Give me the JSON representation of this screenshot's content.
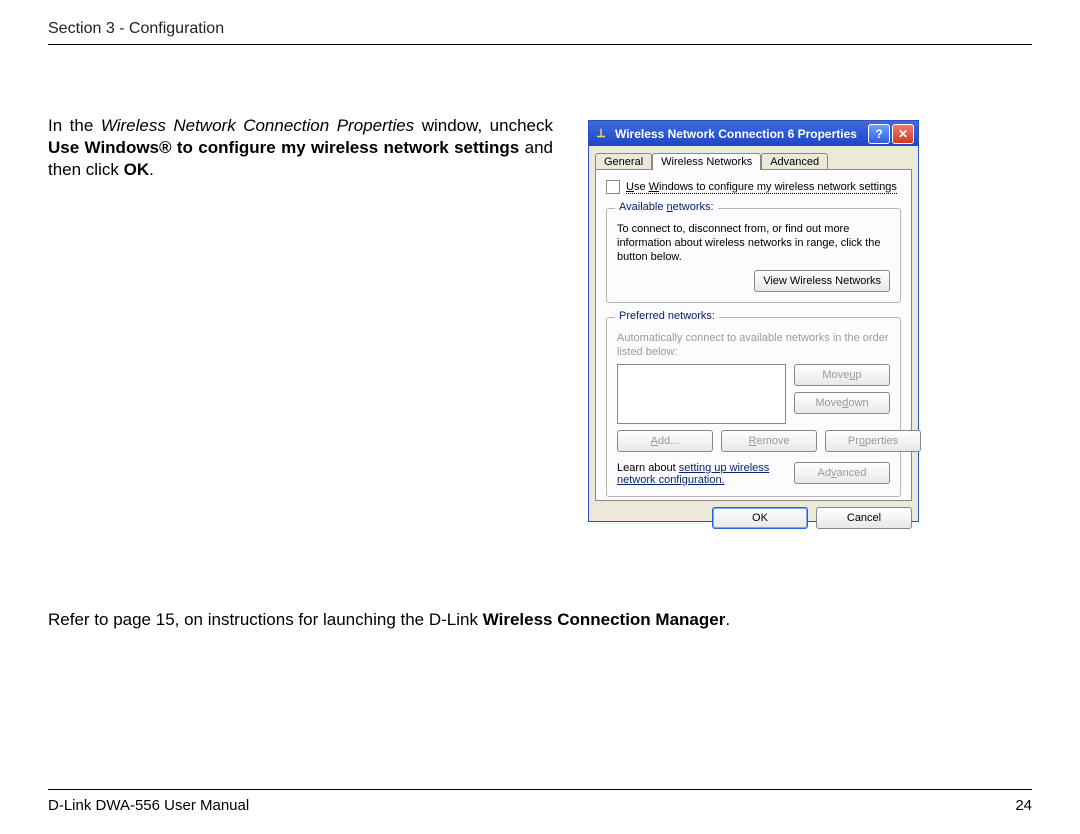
{
  "header": {
    "section": "Section 3 - Configuration"
  },
  "footer": {
    "manual": "D-Link DWA-556 User Manual",
    "page": "24"
  },
  "body": {
    "p1_a": "In the ",
    "p1_italic": "Wireless Network Connection Properties",
    "p1_b": " window, uncheck ",
    "p1_bold": "Use Windows® to configure my wireless network settings",
    "p1_c": " and then click ",
    "p1_ok": "OK",
    "p1_d": ".",
    "p2_a": "Refer to page 15, on instructions for launching the D-Link ",
    "p2_bold": "Wireless Connection Manager",
    "p2_b": "."
  },
  "dialog": {
    "title": "Wireless Network Connection 6 Properties",
    "help": "?",
    "close": "✕",
    "tabs": {
      "general": "General",
      "wireless": "Wireless Networks",
      "advanced": "Advanced"
    },
    "checkbox": {
      "prefix": "U",
      "rest": "se ",
      "w": "W",
      "rest2": "indows to configure my wireless network settings"
    },
    "available": {
      "title_pre": "Available ",
      "title_u": "n",
      "title_post": "etworks:",
      "text": "To connect to, disconnect from, or find out more information about wireless networks in range, click the button below.",
      "btn": "View Wireless Networks"
    },
    "preferred": {
      "title": "Preferred networks:",
      "text": "Automatically connect to available networks in the order listed below:",
      "moveup_pre": "Move ",
      "moveup_u": "u",
      "moveup_post": "p",
      "movedn_pre": "Move ",
      "movedn_u": "d",
      "movedn_post": "own",
      "add_u": "A",
      "add_rest": "dd...",
      "remove_u": "R",
      "remove_rest": "emove",
      "props_pre": "Pr",
      "props_u": "o",
      "props_post": "perties"
    },
    "learn": {
      "pre": "Learn about ",
      "link": "setting up wireless network configuration.",
      "adv_pre": "Ad",
      "adv_u": "v",
      "adv_post": "anced"
    },
    "bottom": {
      "ok": "OK",
      "cancel": "Cancel"
    }
  }
}
